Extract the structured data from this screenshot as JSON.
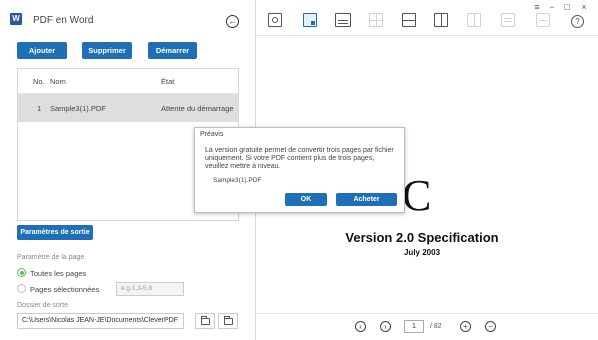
{
  "app": {
    "icon_letter": "W",
    "title": "PDF en Word",
    "back_icon": "arrow-left-icon"
  },
  "actions": {
    "add": "Ajouter",
    "delete": "Supprimer",
    "start": "Démarrer"
  },
  "table": {
    "headers": {
      "no": "No.",
      "name": "Nom",
      "state": "État"
    },
    "rows": [
      {
        "no": "1",
        "name": "Sample3(1).PDF",
        "state": "Attente du démarrage"
      }
    ]
  },
  "output": {
    "params_button": "Paramètres de sortie",
    "page_param_label": "Paramètre de la page",
    "all_pages": "Toutes les pages",
    "selected_pages": "Pages sélectionnées",
    "pages_placeholder": "e.g.1,3-5,8",
    "folder_label": "Dossier de sorte",
    "folder_path": "C:\\Users\\Nicolas JEAN-JE\\Documents\\CleverPDF"
  },
  "document": {
    "large_letter": "C",
    "title": "Version 2.0 Specification",
    "date": "July 2003"
  },
  "pager": {
    "current_page": "1",
    "total": "/ 82",
    "zoom_in": "+",
    "zoom_out": "−"
  },
  "dialog": {
    "title": "Préavis",
    "message": "La version gratuite permet de convertir trois pages par fichier uniquement. Si votre PDF contient plus de trois pages, veuillez mettre à niveau.",
    "file": "Sample3(1).PDF",
    "ok": "OK",
    "buy": "Acheter"
  },
  "colors": {
    "accent": "#1e6fb5",
    "radio_selected": "#5cb85c"
  }
}
